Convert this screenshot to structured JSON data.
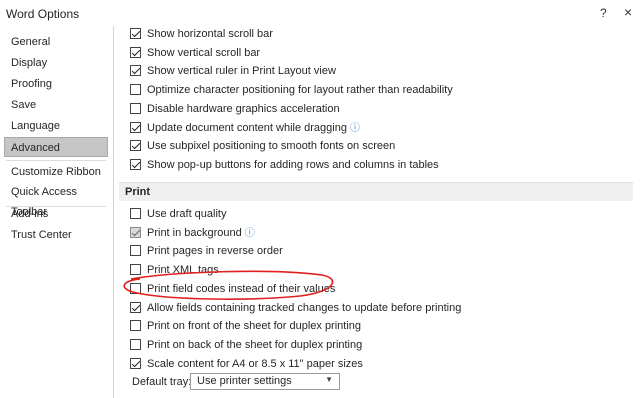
{
  "window": {
    "title": "Word Options",
    "help": "?",
    "close": "×"
  },
  "sidebar": {
    "items": [
      "General",
      "Display",
      "Proofing",
      "Save",
      "Language",
      "Advanced",
      "Customize Ribbon",
      "Quick Access Toolbar",
      "Add-ins",
      "Trust Center"
    ],
    "selected": "Advanced"
  },
  "display_options": [
    {
      "label": "Show horizontal scroll bar",
      "checked": true
    },
    {
      "label": "Show vertical scroll bar",
      "checked": true
    },
    {
      "label": "Show vertical ruler in Print Layout view",
      "checked": true
    },
    {
      "label": "Optimize character positioning for layout rather than readability",
      "checked": false
    },
    {
      "label": "Disable hardware graphics acceleration",
      "checked": false
    },
    {
      "label": "Update document content while dragging",
      "checked": true,
      "info": "ⓘ"
    },
    {
      "label": "Use subpixel positioning to smooth fonts on screen",
      "checked": true
    },
    {
      "label": "Show pop-up buttons for adding rows and columns in tables",
      "checked": true
    }
  ],
  "print_section": {
    "heading": "Print",
    "options": [
      {
        "label": "Use draft quality",
        "checked": false
      },
      {
        "label": "Print in background",
        "checked": true,
        "disabled": true,
        "info": "ⓘ"
      },
      {
        "label": "Print pages in reverse order",
        "checked": false
      },
      {
        "label": "Print XML tags",
        "checked": false
      },
      {
        "label": "Print field codes instead of their values",
        "checked": false
      },
      {
        "label": "Allow fields containing tracked changes to update before printing",
        "checked": true
      },
      {
        "label": "Print on front of the sheet for duplex printing",
        "checked": false
      },
      {
        "label": "Print on back of the sheet for duplex printing",
        "checked": false
      },
      {
        "label": "Scale content for A4 or 8.5 x 11\" paper sizes",
        "checked": true
      }
    ],
    "default_tray": {
      "label": "Default tray:",
      "value": "Use printer settings"
    }
  },
  "annotation_color": "#e02020"
}
